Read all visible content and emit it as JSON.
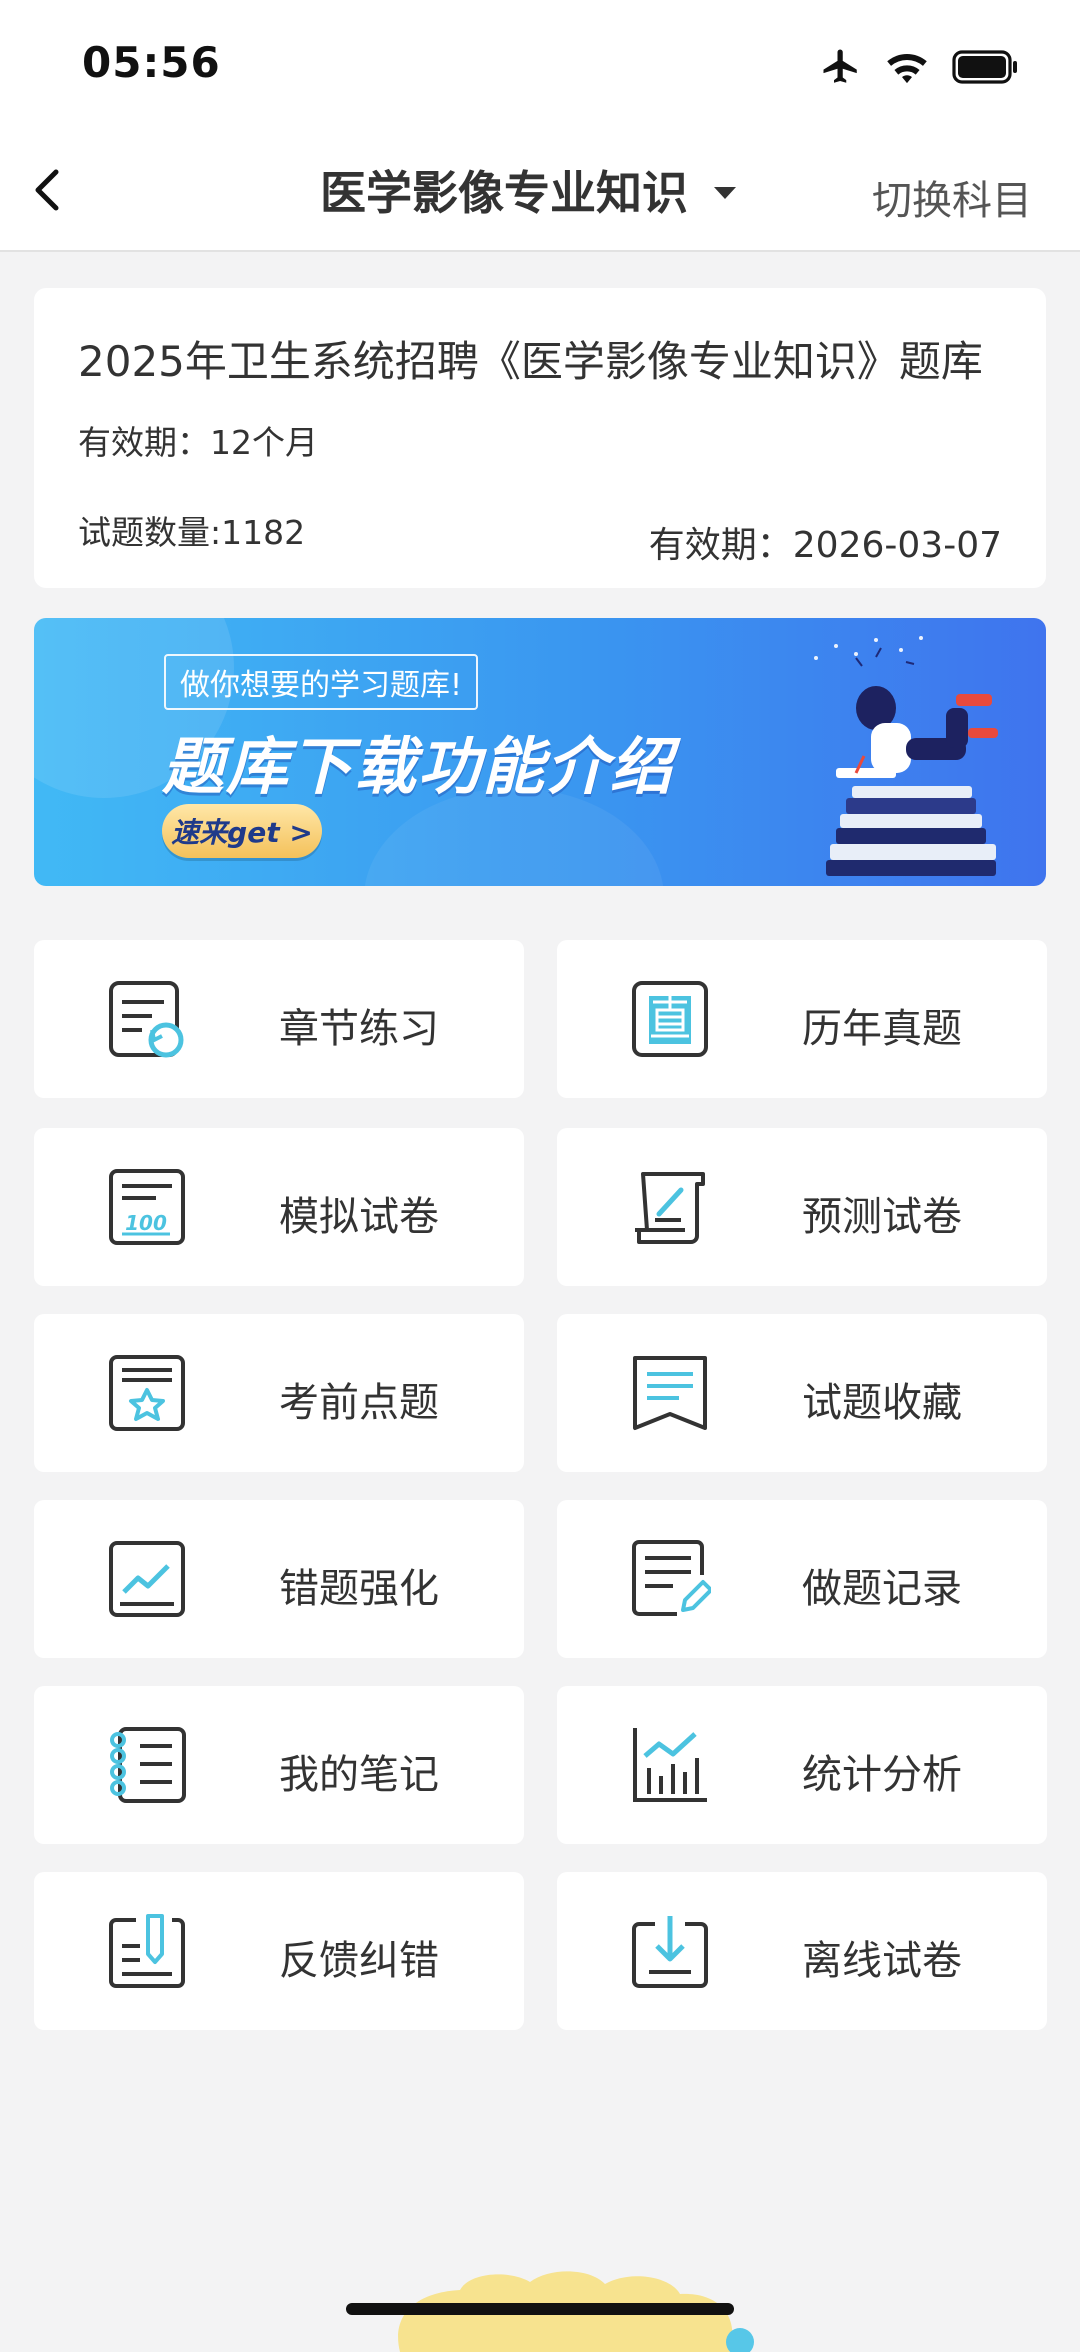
{
  "status_bar": {
    "time": "05:56"
  },
  "nav": {
    "title": "医学影像专业知识",
    "switch_label": "切换科目"
  },
  "card": {
    "title": "2025年卫生系统招聘《医学影像专业知识》题库",
    "validity_label": "有效期：12个月",
    "question_count": "试题数量:1182",
    "expire_date": "有效期：2026-03-07"
  },
  "banner": {
    "tagline": "做你想要的学习题库!",
    "headline": "题库下载功能介绍",
    "button": "速来get >"
  },
  "grid": [
    {
      "label": "章节练习",
      "icon": "chapter-practice-icon"
    },
    {
      "label": "历年真题",
      "icon": "past-exams-icon"
    },
    {
      "label": "模拟试卷",
      "icon": "mock-exam-icon"
    },
    {
      "label": "预测试卷",
      "icon": "predict-exam-icon"
    },
    {
      "label": "考前点题",
      "icon": "pre-exam-tips-icon"
    },
    {
      "label": "试题收藏",
      "icon": "favorites-icon"
    },
    {
      "label": "错题强化",
      "icon": "wrong-questions-icon"
    },
    {
      "label": "做题记录",
      "icon": "practice-record-icon"
    },
    {
      "label": "我的笔记",
      "icon": "notes-icon"
    },
    {
      "label": "统计分析",
      "icon": "statistics-icon"
    },
    {
      "label": "反馈纠错",
      "icon": "feedback-icon"
    },
    {
      "label": "离线试卷",
      "icon": "offline-download-icon"
    }
  ],
  "colors": {
    "accent": "#4cc3e0",
    "icon_stroke": "#333333",
    "background": "#f3f3f4"
  }
}
